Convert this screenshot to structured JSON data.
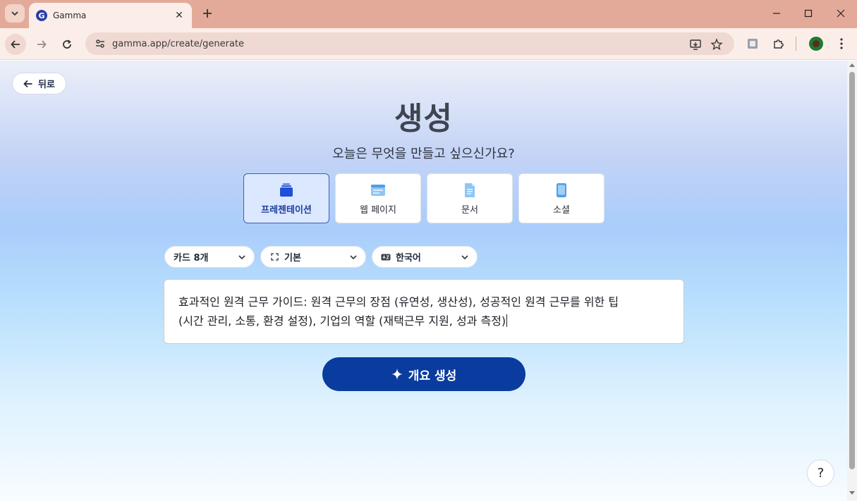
{
  "browser": {
    "tab_title": "Gamma",
    "tab_favicon_letter": "G",
    "url": "gamma.app/create/generate"
  },
  "page": {
    "back_label": "뒤로",
    "title": "생성",
    "subtitle": "오늘은 무엇을 만들고 싶으신가요?",
    "types": [
      {
        "label": "프레젠테이션",
        "icon": "presentation-icon",
        "selected": true
      },
      {
        "label": "웹 페이지",
        "icon": "webpage-icon",
        "selected": false
      },
      {
        "label": "문서",
        "icon": "document-icon",
        "selected": false
      },
      {
        "label": "소셜",
        "icon": "social-icon",
        "selected": false
      }
    ],
    "options": {
      "cards": "카드 8개",
      "format": "기본",
      "language": "한국어"
    },
    "prompt_line1": "효과적인 원격 근무 가이드: 원격 근무의 장점 (유연성, 생산성), 성공적인 원격 근무를 위한 팁",
    "prompt_line2": "(시간 관리, 소통, 환경 설정), 기업의 역할 (재택근무 지원, 성과 측정)",
    "generate_label": "개요 생성",
    "help_label": "?"
  },
  "colors": {
    "accent": "#0a3c9f",
    "tab_bar": "#e3aa9a",
    "selected_card": "#dbe8ff"
  }
}
